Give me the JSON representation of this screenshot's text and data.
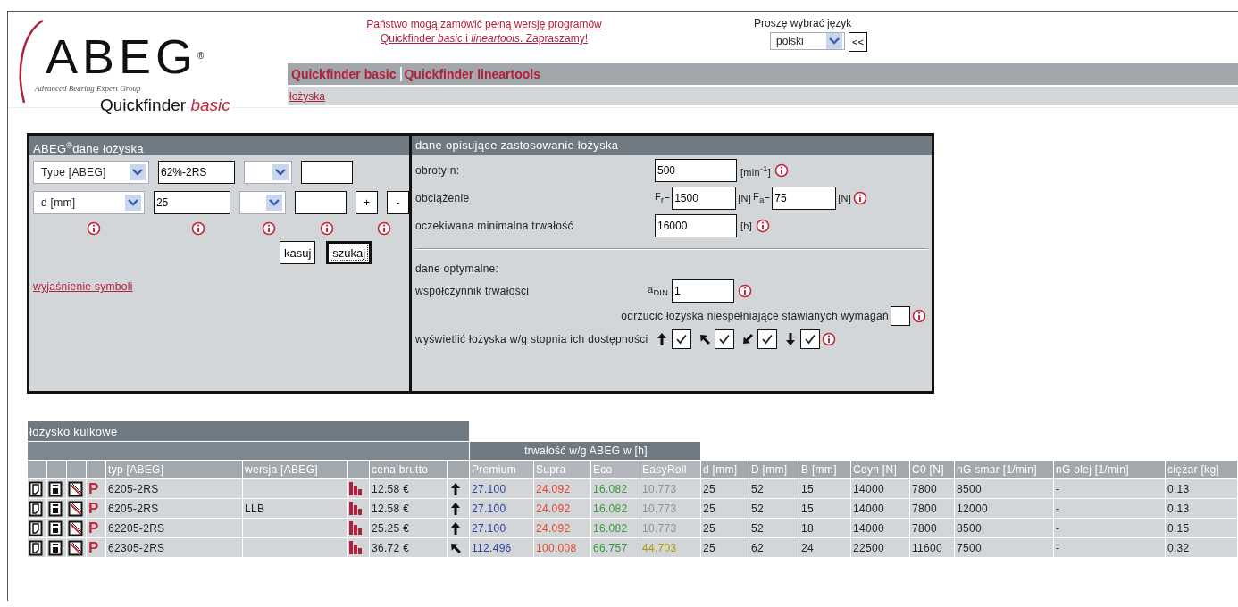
{
  "header": {
    "logo": "ABEG",
    "logo_mark": "®",
    "logo_subtitle": "Advanced Bearing Expert Group",
    "product": "Quickfinder *basic*",
    "promo": [
      "Państwo mogą zamówić pełną wersję programów",
      "Quickfinder *basic* i *lineartools*. Zapraszamy!"
    ],
    "language": {
      "label": "Proszę wybrać język",
      "value": "polski",
      "button": "<<"
    },
    "nav": [
      "Quickfinder basic",
      "Quickfinder lineartools"
    ],
    "subnav": [
      "łożyska"
    ]
  },
  "bearing_data": {
    "title": "ABEG$^{®}$dane łożyska",
    "rows": [
      {
        "criterion": "Type [ABEG]",
        "value": "62%-2RS"
      },
      {
        "criterion": "d [mm]",
        "value": "25",
        "buttons": [
          "+",
          "-"
        ]
      }
    ],
    "buttons": [
      {
        "label": "kasuj",
        "focused": false
      },
      {
        "label": "szukaj",
        "focused": true
      }
    ],
    "link": "wyjaśnienie symboli"
  },
  "application_data": {
    "title": "dane opisujące zastosowanie łożyska",
    "speed": {
      "label": "obroty n:",
      "value": "500",
      "unit": "[min$^{-1}$]"
    },
    "load": {
      "label": "obciążenie",
      "radial_prefix": "F$_{r}$=",
      "radial": "1500",
      "radial_unit": "[N]",
      "axial_prefix": "F$_{a}$=",
      "axial": "75",
      "axial_unit": "[N]"
    },
    "life": {
      "label": "oczekiwana minimalna trwałość",
      "value": "16000",
      "unit": "[h]"
    },
    "optimal_heading": "dane optymalne:",
    "factor": {
      "label": "współczynnik trwałości",
      "prefix": "a$_{DIN}$",
      "value": "1"
    },
    "reject": {
      "label": "odrzucić łożyska niespełniające stawianych wymagań",
      "checked": false
    },
    "availability": {
      "label": "wyświetlić łożyska w/g stopnia ich dostępności",
      "options": [
        {
          "kind": "up",
          "checked": true
        },
        {
          "kind": "up-left",
          "checked": true
        },
        {
          "kind": "down-left",
          "checked": true
        },
        {
          "kind": "down",
          "checked": true
        }
      ]
    }
  },
  "results": {
    "title": "łożysko kulkowe",
    "life_group": "trwałość w/g ABEG w [h]",
    "columns": [
      "typ [ABEG]",
      "wersja [ABEG]",
      "cena brutto",
      "Premium",
      "Supra",
      "Eco",
      "EasyRoll",
      "d [mm]",
      "D [mm]",
      "B [mm]",
      "Cdyn [N]",
      "C0 [N]",
      "nG smar [1/min]",
      "nG olej [1/min]",
      "ciężar [kg]"
    ],
    "rows": [
      {
        "badge": "P",
        "type": "6205-2RS",
        "price": "12.58 €",
        "arrow": {
          "kind": "up"
        },
        "premium": "27.100",
        "supra": "24.092",
        "eco": "16.082",
        "easyroll": {
          "value": "10.773",
          "color": "#8e9196"
        },
        "d": "25",
        "D": "52",
        "B": "15",
        "cdyn": "14000",
        "c0": "7800",
        "ng_grease": "8500",
        "ng_oil": "-",
        "weight": "0.13"
      },
      {
        "badge": "P",
        "type": "6205-2RS",
        "version": "LLB",
        "price": "12.58 €",
        "arrow": {
          "kind": "up"
        },
        "premium": "27.100",
        "supra": "24.092",
        "eco": "16.082",
        "easyroll": {
          "value": "10.773",
          "color": "#8e9196"
        },
        "d": "25",
        "D": "52",
        "B": "15",
        "cdyn": "14000",
        "c0": "7800",
        "ng_grease": "12000",
        "ng_oil": "-",
        "weight": "0.13"
      },
      {
        "badge": "P",
        "type": "62205-2RS",
        "price": "25.25 €",
        "arrow": {
          "kind": "up"
        },
        "premium": "27.100",
        "supra": "24.092",
        "eco": "16.082",
        "easyroll": {
          "value": "10.773",
          "color": "#8e9196"
        },
        "d": "25",
        "D": "52",
        "B": "18",
        "cdyn": "14000",
        "c0": "7800",
        "ng_grease": "8500",
        "ng_oil": "-",
        "weight": "0.15"
      },
      {
        "badge": "P",
        "type": "62305-2RS",
        "price": "36.72 €",
        "arrow": {
          "kind": "up-left"
        },
        "premium": "112.496",
        "supra": "100.008",
        "eco": "66.757",
        "easyroll": {
          "value": "44.703",
          "color": "#a89a00"
        },
        "d": "25",
        "D": "62",
        "B": "24",
        "cdyn": "22500",
        "c0": "11600",
        "ng_grease": "7500",
        "ng_oil": "-",
        "weight": "0.32"
      }
    ]
  }
}
